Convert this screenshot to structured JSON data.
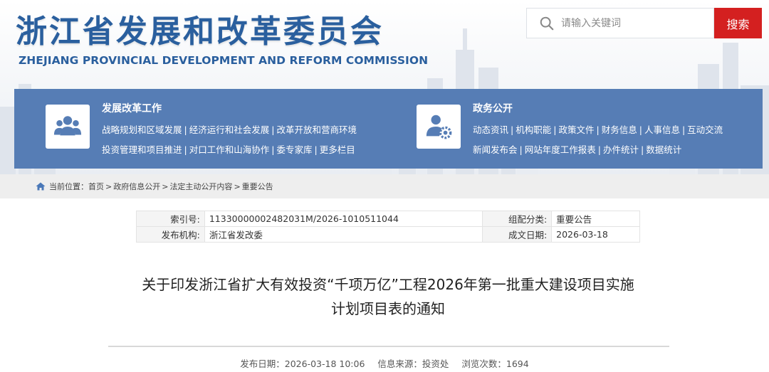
{
  "site": {
    "title": "浙江省发展和改革委员会",
    "subtitle": "ZHEJIANG PROVINCIAL DEVELOPMENT AND REFORM COMMISSION"
  },
  "search": {
    "placeholder": "请输入关键词",
    "button_label": "搜索"
  },
  "nav": {
    "sections": [
      {
        "title": "发展改革工作",
        "icon": "people-group-icon",
        "line1": [
          "战略规划和区域发展",
          "经济运行和社会发展",
          "改革开放和营商环境"
        ],
        "line2": [
          "投资管理和项目推进",
          "对口工作和山海协作",
          "委专家库",
          "更多栏目"
        ]
      },
      {
        "title": "政务公开",
        "icon": "user-gear-icon",
        "line1": [
          "动态资讯",
          "机构职能",
          "政策文件",
          "财务信息",
          "人事信息",
          "互动交流"
        ],
        "line2": [
          "新闻发布会",
          "网站年度工作报表",
          "办件统计",
          "数据统计"
        ]
      }
    ],
    "separator": "|"
  },
  "breadcrumb": {
    "prefix": "当前位置：",
    "items": [
      "首页",
      "政府信息公开",
      "法定主动公开内容",
      "重要公告"
    ],
    "separator": ">"
  },
  "meta": {
    "index_label": "索引号:",
    "index_value": "11330000002482031M/2026-1010511044",
    "category_label": "组配分类:",
    "category_value": "重要公告",
    "publisher_label": "发布机构:",
    "publisher_value": "浙江省发改委",
    "date_label": "成文日期:",
    "date_value": "2026-03-18"
  },
  "article": {
    "title_line1": "关于印发浙江省扩大有效投资“千项万亿”工程2026年第一批重大建设项目实施",
    "title_line2": "计划项目表的通知",
    "publish_date": "发布日期：2026-03-18 10:06",
    "source": "信息来源：投资处",
    "views": "浏览次数：1694"
  },
  "colors": {
    "brand_blue": "#2a5f9e",
    "nav_blue": "#567db5",
    "search_red": "#d42020"
  }
}
